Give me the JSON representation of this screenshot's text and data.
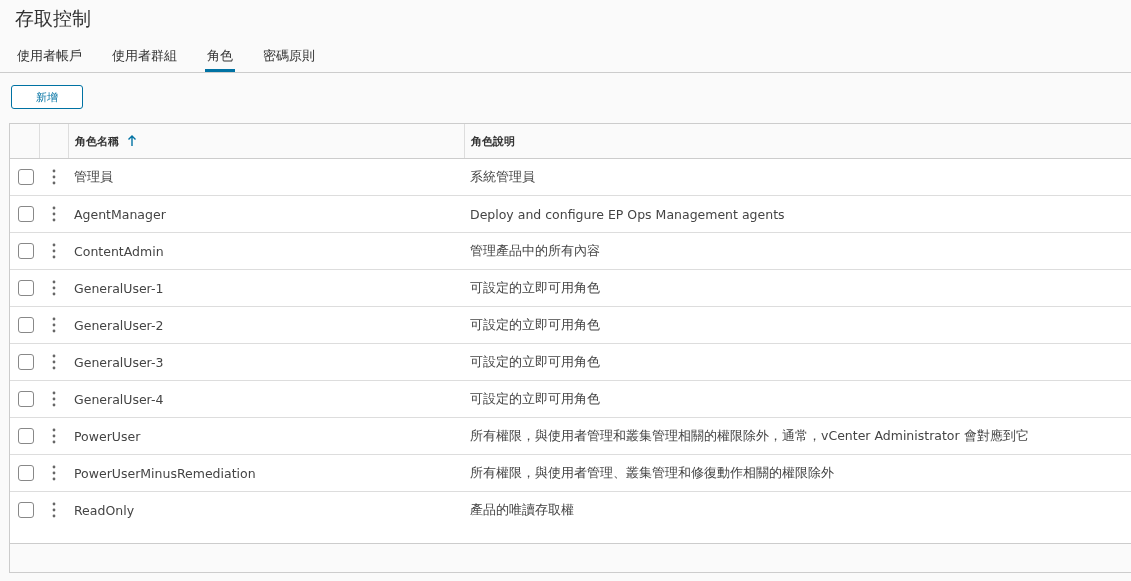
{
  "page": {
    "title": "存取控制"
  },
  "tabs": [
    {
      "label": "使用者帳戶",
      "selected": false
    },
    {
      "label": "使用者群組",
      "selected": false
    },
    {
      "label": "角色",
      "selected": true
    },
    {
      "label": "密碼原則",
      "selected": false
    }
  ],
  "add_button": "新增",
  "table": {
    "columns": [
      {
        "label": "角色名稱",
        "sorted": true
      },
      {
        "label": "角色說明",
        "sorted": false
      }
    ],
    "rows": [
      {
        "checked": false,
        "name": "管理員",
        "description": "系統管理員"
      },
      {
        "checked": false,
        "name": "AgentManager",
        "description": "Deploy and configure EP Ops Management agents"
      },
      {
        "checked": false,
        "name": "ContentAdmin",
        "description": "管理產品中的所有內容"
      },
      {
        "checked": false,
        "name": "GeneralUser-1",
        "description": "可設定的立即可用角色"
      },
      {
        "checked": false,
        "name": "GeneralUser-2",
        "description": "可設定的立即可用角色"
      },
      {
        "checked": false,
        "name": "GeneralUser-3",
        "description": "可設定的立即可用角色"
      },
      {
        "checked": false,
        "name": "GeneralUser-4",
        "description": "可設定的立即可用角色"
      },
      {
        "checked": false,
        "name": "PowerUser",
        "description": "所有權限，與使用者管理和叢集管理相關的權限除外，通常，vCenter Administrator 會對應到它"
      },
      {
        "checked": false,
        "name": "PowerUserMinusRemediation",
        "description": "所有權限，與使用者管理、叢集管理和修復動作相關的權限除外"
      },
      {
        "checked": false,
        "name": "ReadOnly",
        "description": "產品的唯讀存取權"
      }
    ]
  }
}
